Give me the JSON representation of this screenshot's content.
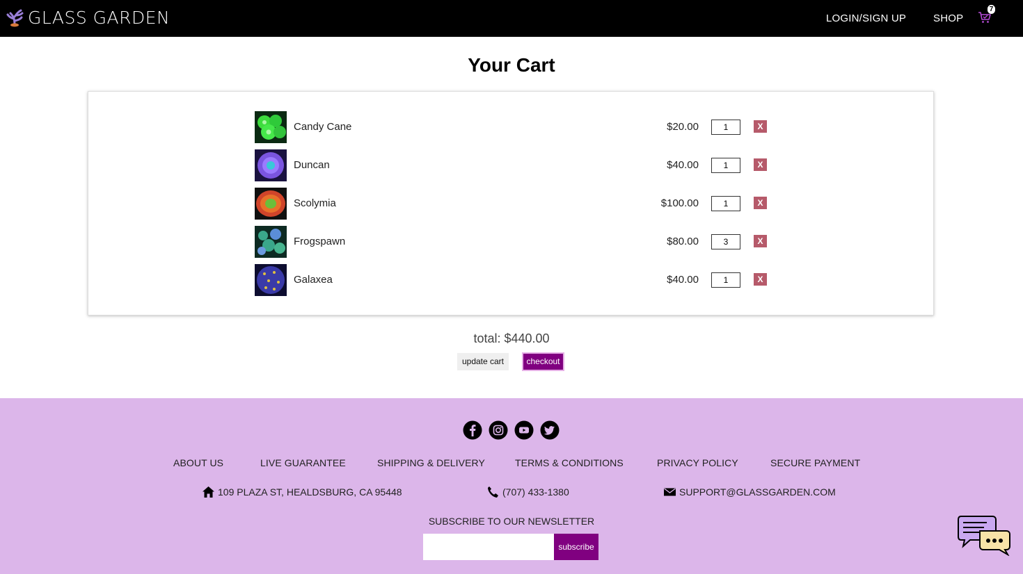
{
  "nav": {
    "brand": "GLASS GARDEN",
    "login": "LOGIN/SIGN UP",
    "shop": "SHOP",
    "cart_count": "7"
  },
  "page_title": "Your Cart",
  "cart": {
    "items": [
      {
        "name": "Candy Cane",
        "price": "$20.00",
        "qty": "1",
        "remove": "X",
        "color": "#3ddc3d"
      },
      {
        "name": "Duncan",
        "price": "$40.00",
        "qty": "1",
        "remove": "X",
        "color": "#7a55e0"
      },
      {
        "name": "Scolymia",
        "price": "$100.00",
        "qty": "1",
        "remove": "X",
        "color": "#d0442a"
      },
      {
        "name": "Frogspawn",
        "price": "$80.00",
        "qty": "3",
        "remove": "X",
        "color": "#3aa78a"
      },
      {
        "name": "Galaxea",
        "price": "$40.00",
        "qty": "1",
        "remove": "X",
        "color": "#3a3aa8"
      }
    ],
    "total": "total: $440.00",
    "update_label": "update cart",
    "checkout_label": "checkout"
  },
  "footer": {
    "links": [
      "ABOUT US",
      "LIVE GUARANTEE",
      "SHIPPING & DELIVERY",
      "TERMS & CONDITIONS",
      "PRIVACY POLICY",
      "SECURE PAYMENT"
    ],
    "address": "109 PLAZA ST, HEALDSBURG, CA 95448",
    "phone": "(707) 433-1380",
    "email": "SUPPORT@GLASSGARDEN.COM",
    "newsletter_title": "SUBSCRIBE TO OUR NEWSLETTER",
    "subscribe_label": "subscribe"
  },
  "colors": {
    "accent": "#800080",
    "footer_bg": "#dcb6ea",
    "remove_btn": "#b65a6a",
    "navbar": "#000000"
  },
  "icons": [
    "coral-logo-icon",
    "cart-icon",
    "facebook-icon",
    "instagram-icon",
    "youtube-icon",
    "twitter-icon",
    "home-icon",
    "phone-icon",
    "mail-icon",
    "chat-icon"
  ]
}
